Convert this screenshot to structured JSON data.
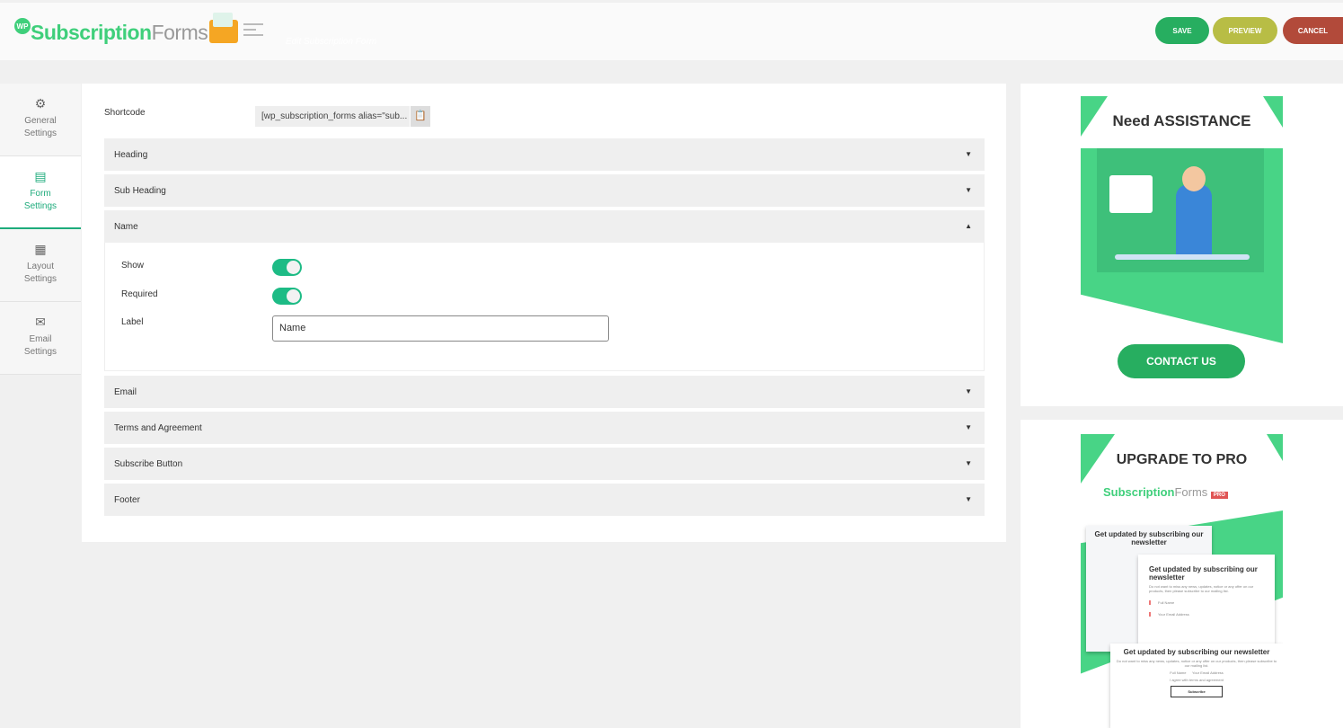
{
  "header": {
    "logo_badge": "WP",
    "logo_part1": "Subscription",
    "logo_part2": "Forms",
    "subtitle": "Edit Subscription Form",
    "save": "SAVE",
    "preview": "PREVIEW",
    "cancel": "CANCEL"
  },
  "colors": {
    "accent": "#1dab7b",
    "save": "#27ae60",
    "preview": "#b8bd45",
    "cancel": "#b24a3a",
    "promo_green": "#48d486"
  },
  "sidebar": {
    "items": [
      {
        "label1": "General",
        "label2": "Settings",
        "icon": "gear-icon"
      },
      {
        "label1": "Form",
        "label2": "Settings",
        "icon": "form-icon",
        "active": true
      },
      {
        "label1": "Layout",
        "label2": "Settings",
        "icon": "layout-icon"
      },
      {
        "label1": "Email",
        "label2": "Settings",
        "icon": "envelope-icon"
      }
    ]
  },
  "main": {
    "shortcode_label": "Shortcode",
    "shortcode_value": "[wp_subscription_forms alias=\"sub...",
    "sections": [
      "Heading",
      "Sub Heading",
      "Name",
      "Email",
      "Terms and Agreement",
      "Subscribe Button",
      "Footer"
    ],
    "name_section": {
      "show_label": "Show",
      "show": true,
      "required_label": "Required",
      "required": true,
      "label_label": "Label",
      "label_value": "Name"
    }
  },
  "promo": {
    "assist_title": "Need ASSISTANCE",
    "contact": "CONTACT US",
    "upgrade_title": "UPGRADE TO PRO",
    "pro_badge": "PRO",
    "preview_heading": "Get updated by subscribing our newsletter",
    "preview_text": "Do not want to miss any news, updates, notice or any offer on our products, then please subscribe to our mailing list.",
    "full_name": "Full Name",
    "email": "Your Email Address",
    "agree": "I agree with terms and agreement",
    "subscribe": "Subscribe"
  }
}
